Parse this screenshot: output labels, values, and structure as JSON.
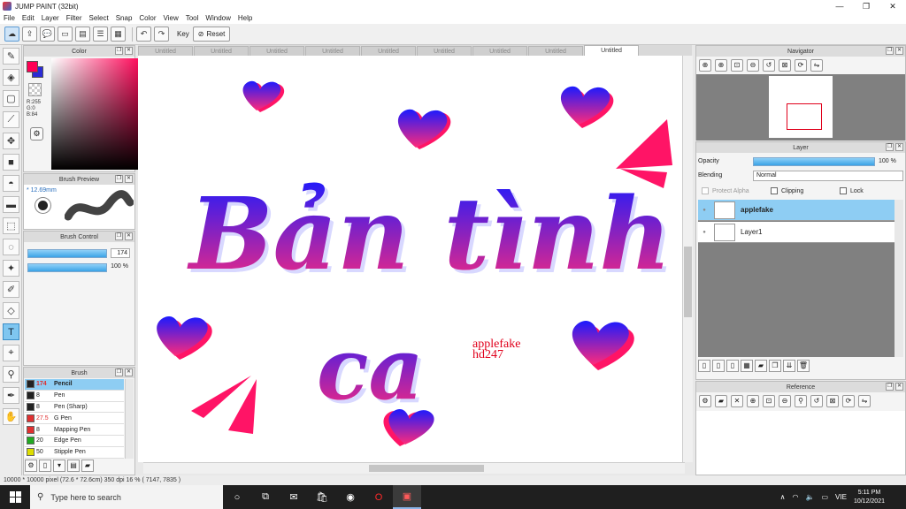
{
  "window": {
    "title": "JUMP PAINT (32bit)"
  },
  "menu": [
    "File",
    "Edit",
    "Layer",
    "Filter",
    "Select",
    "Snap",
    "Color",
    "View",
    "Tool",
    "Window",
    "Help"
  ],
  "toolbar": {
    "key_label": "Key",
    "reset_label": "Reset"
  },
  "color_panel": {
    "title": "Color",
    "r": "R:255",
    "g": "G:0",
    "b": "B:84",
    "fg_color": "#ff0054",
    "bg_color": "#2b2bd6"
  },
  "brush_preview": {
    "title": "Brush Preview",
    "size": "* 12.69mm"
  },
  "brush_control": {
    "title": "Brush Control",
    "size_value": "174",
    "opacity_value": "100 %"
  },
  "brush_panel": {
    "title": "Brush",
    "items": [
      {
        "size": "174",
        "name": "Pencil",
        "color": "#222222"
      },
      {
        "size": "8",
        "name": "Pen",
        "color": "#222222"
      },
      {
        "size": "8",
        "name": "Pen (Sharp)",
        "color": "#222222"
      },
      {
        "size": "27.5",
        "name": "G Pen",
        "color": "#e03030"
      },
      {
        "size": "8",
        "name": "Mapping Pen",
        "color": "#e03030"
      },
      {
        "size": "20",
        "name": "Edge Pen",
        "color": "#22aa22"
      },
      {
        "size": "50",
        "name": "Stipple Pen",
        "color": "#dddd00"
      }
    ]
  },
  "tabs": [
    "Untitled",
    "Untitled",
    "Untitled",
    "Untitled",
    "Untitled",
    "Untitled",
    "Untitled",
    "Untitled",
    "Untitled"
  ],
  "canvas": {
    "title_line1": "Bản tình",
    "title_line2": "ca",
    "watermark1": "applefake",
    "watermark2": "hd247"
  },
  "navigator": {
    "title": "Navigator"
  },
  "layer_panel": {
    "title": "Layer",
    "opacity_label": "Opacity",
    "opacity_value": "100 %",
    "blending_label": "Blending",
    "blending_value": "Normal",
    "protect_alpha": "Protect Alpha",
    "clipping": "Clipping",
    "lock": "Lock",
    "layers": [
      {
        "name": "applefake",
        "selected": true
      },
      {
        "name": "Layer1",
        "selected": false
      }
    ]
  },
  "reference": {
    "title": "Reference"
  },
  "status": {
    "text": "10000 * 10000 pixel  (72.6 * 72.6cm)  350 dpi  16 %  ( 7147, 7835 )"
  },
  "taskbar": {
    "search_placeholder": "Type here to search",
    "lang": "VIE",
    "time": "5:11 PM",
    "date": "10/12/2021"
  }
}
